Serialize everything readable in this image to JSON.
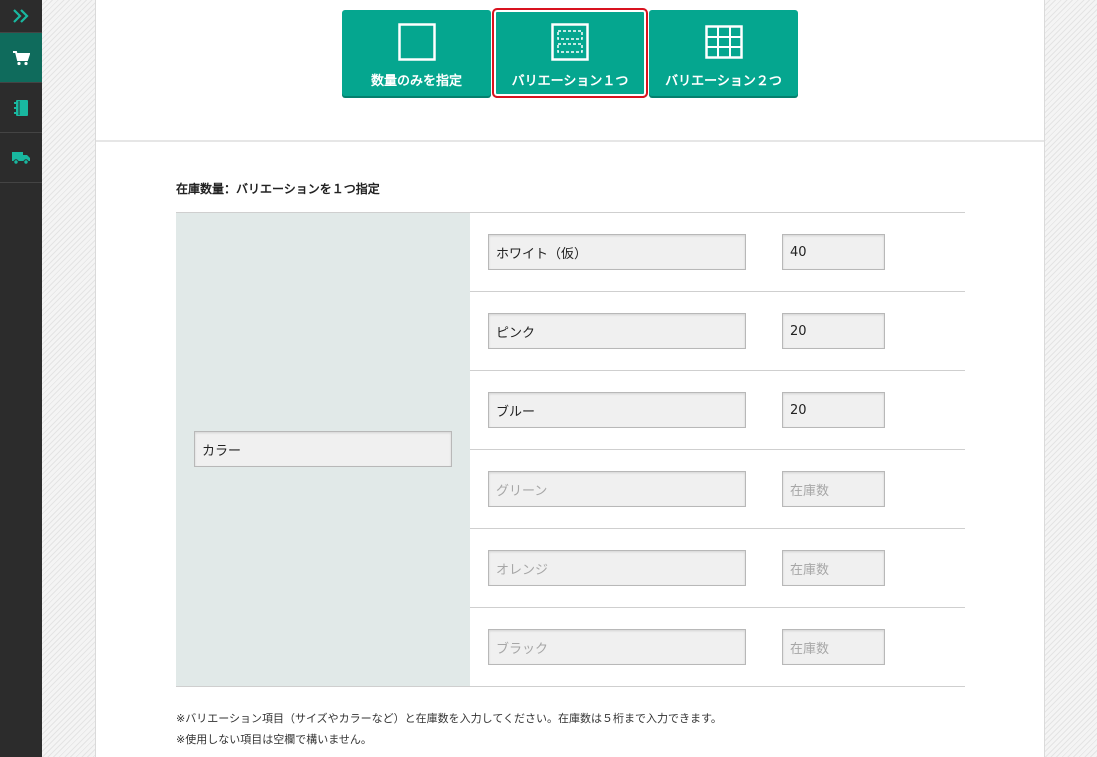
{
  "sidebar": {
    "items": [
      {
        "icon": "chevron-double-right-icon"
      },
      {
        "icon": "cart-icon"
      },
      {
        "icon": "notebook-icon"
      },
      {
        "icon": "truck-icon"
      }
    ],
    "accent": "#0f6b5c"
  },
  "modes": {
    "quantity_only": "数量のみを指定",
    "variation_one": "バリエーション１つ",
    "variation_two": "バリエーション２つ",
    "selected": "variation_one",
    "button_color": "#05a68f",
    "selected_outline_color": "#d8121f"
  },
  "stock": {
    "title": "在庫数量：バリエーションを１つ指定",
    "variation_name": "カラー",
    "rows": [
      {
        "name": "ホワイト（仮）",
        "qty": "40",
        "name_placeholder": false,
        "qty_placeholder": false
      },
      {
        "name": "ピンク",
        "qty": "20",
        "name_placeholder": false,
        "qty_placeholder": false
      },
      {
        "name": "ブルー",
        "qty": "20",
        "name_placeholder": false,
        "qty_placeholder": false
      },
      {
        "name": "グリーン",
        "qty": "在庫数",
        "name_placeholder": true,
        "qty_placeholder": true
      },
      {
        "name": "オレンジ",
        "qty": "在庫数",
        "name_placeholder": true,
        "qty_placeholder": true
      },
      {
        "name": "ブラック",
        "qty": "在庫数",
        "name_placeholder": true,
        "qty_placeholder": true
      }
    ]
  },
  "notes": {
    "line1": "※バリエーション項目（サイズやカラーなど）と在庫数を入力してください。在庫数は５桁まで入力できます。",
    "line2": "※使用しない項目は空欄で構いません。"
  }
}
